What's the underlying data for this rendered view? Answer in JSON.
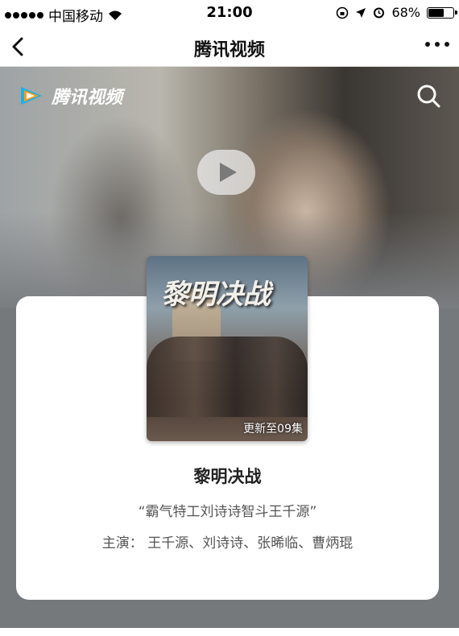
{
  "status": {
    "carrier": "中国移动",
    "time": "21:00",
    "battery_text": "68%",
    "battery_level": 0.68
  },
  "nav": {
    "title": "腾讯视频"
  },
  "hero": {
    "logo_text": "腾讯视频",
    "logo_colors": [
      "#1db0e8",
      "#ff9a1a",
      "#2fc25b"
    ]
  },
  "poster": {
    "title_art": "黎明决战",
    "badge": "更新至09集"
  },
  "show": {
    "title": "黎明决战",
    "tagline": "“霸气特工刘诗诗智斗王千源”",
    "cast": "主演： 王千源、刘诗诗、张晞临、曹炳琨"
  }
}
